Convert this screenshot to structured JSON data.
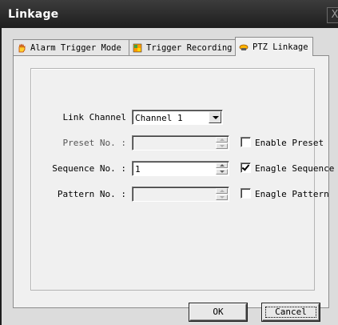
{
  "window": {
    "title": "Linkage",
    "close_glyph": "X"
  },
  "tabs": [
    {
      "label": "Alarm Trigger Mode",
      "icon": "alarm-hand-icon",
      "active": false
    },
    {
      "label": "Trigger Recording",
      "icon": "recording-icon",
      "active": false
    },
    {
      "label": "PTZ Linkage",
      "icon": "ptz-icon",
      "active": true
    }
  ],
  "form": {
    "link_channel": {
      "label": "Link Channel",
      "value": "Channel 1"
    },
    "preset": {
      "label": "Preset No. :",
      "value": "",
      "enabled": false,
      "checkbox_label": "Enable Preset",
      "checked": false
    },
    "sequence": {
      "label": "Sequence No. :",
      "value": "1",
      "enabled": true,
      "checkbox_label": "Enagle Sequence",
      "checked": true
    },
    "pattern": {
      "label": "Pattern No. :",
      "value": "",
      "enabled": false,
      "checkbox_label": "Enagle Pattern",
      "checked": false
    }
  },
  "buttons": {
    "ok": "OK",
    "cancel": "Cancel"
  },
  "colors": {
    "titlebar": "#2a2a2a",
    "dialog_bg": "#dcdcdc",
    "panel_bg": "#f0f0f0"
  }
}
